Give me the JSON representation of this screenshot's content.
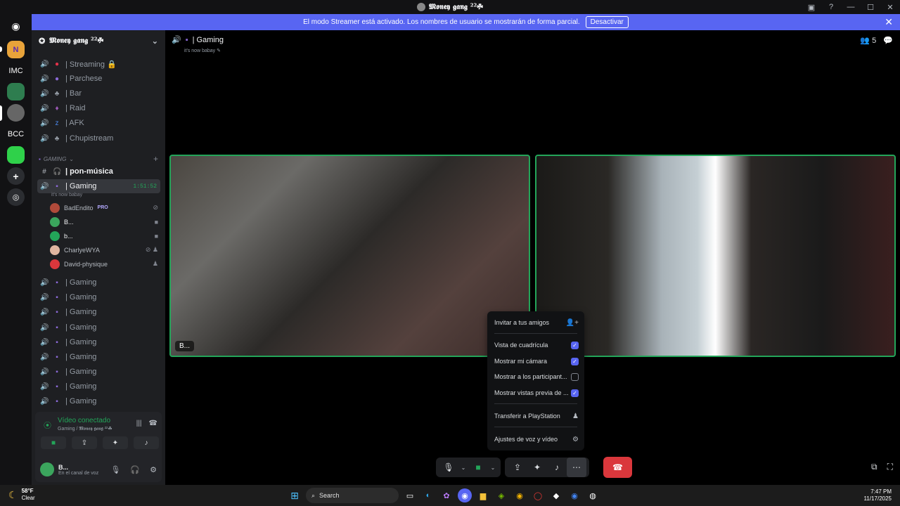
{
  "window": {
    "title": "𝕸𝖔𝖓𝖊𝖞 𝖌𝖆𝖓𝖌 ²²☘"
  },
  "banner": {
    "text": "El modo Streamer está activado. Los nombres de usuario se mostrarán de forma parcial.",
    "button": "Desactivar"
  },
  "guilds": [
    {
      "label": "N"
    },
    {
      "label": "IMC"
    },
    {
      "label": ""
    },
    {
      "label": ""
    },
    {
      "label": "BCC"
    },
    {
      "label": ""
    },
    {
      "label": "+"
    },
    {
      "label": ""
    }
  ],
  "server": {
    "name": "𝕸𝖔𝖓𝖊𝖞 𝖌𝖆𝖓𝖌 ²²☘"
  },
  "channels_top": [
    {
      "label": "| Streaming 🔒"
    },
    {
      "label": "| Parchese"
    },
    {
      "label": "| Bar"
    },
    {
      "label": "| Raid"
    },
    {
      "label": "| AFK"
    },
    {
      "label": "| Chupistream"
    }
  ],
  "category": {
    "label": "GAMING"
  },
  "text_channel": {
    "label": "| pon-música"
  },
  "active_channel": {
    "label": "| Gaming",
    "time": "1:51:52",
    "status": "it's now babay"
  },
  "voice_users": [
    {
      "name": "BadEndito",
      "badge": "PRO"
    },
    {
      "name": "B..."
    },
    {
      "name": "b..."
    },
    {
      "name": "CharlyeWYA"
    },
    {
      "name": "David-physique"
    }
  ],
  "channels_bottom": [
    {
      "label": "| Gaming"
    },
    {
      "label": "| Gaming"
    },
    {
      "label": "| Gaming"
    },
    {
      "label": "| Gaming"
    },
    {
      "label": "| Gaming"
    },
    {
      "label": "| Gaming"
    },
    {
      "label": "| Gaming"
    },
    {
      "label": "| Gaming"
    },
    {
      "label": "| Gaming"
    }
  ],
  "voice_panel": {
    "title": "Vídeo conectado",
    "sub": "Gaming / 𝕸𝖔𝖓𝖊𝖞 𝖌𝖆𝖓𝖌 ²²☘"
  },
  "user_panel": {
    "name": "B...",
    "status": "En el canal de voz"
  },
  "main": {
    "channel": "| Gaming",
    "status": "it's now babay",
    "member_count": "5"
  },
  "tiles": [
    {
      "name": "B..."
    }
  ],
  "menu": {
    "invite": "Invitar a tus amigos",
    "grid": "Vista de cuadrícula",
    "camera": "Mostrar mi cámara",
    "participants": "Mostrar a los participant...",
    "previews": "Mostrar vistas previa de ...",
    "playstation": "Transferir a PlayStation",
    "settings": "Ajustes de voz y vídeo"
  },
  "taskbar": {
    "temp": "58°F",
    "condition": "Clear",
    "search": "Search",
    "time": "7:47 PM",
    "date": "11/17/2025"
  }
}
